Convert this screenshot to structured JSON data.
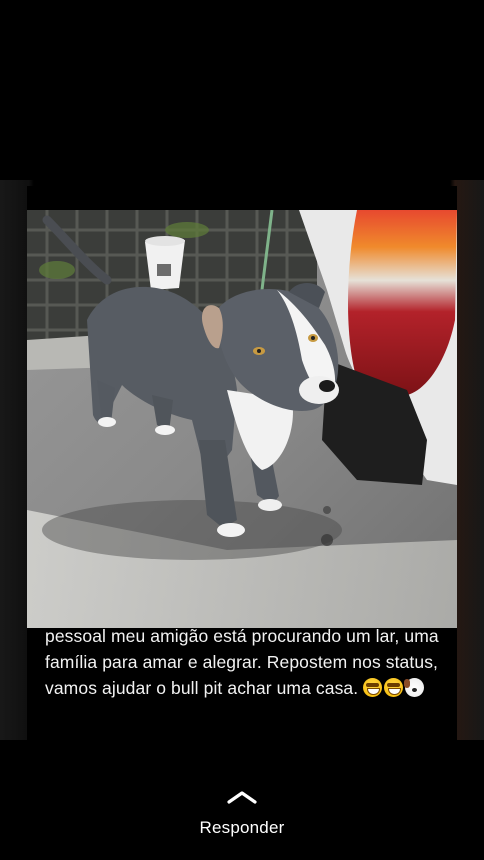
{
  "post": {
    "caption": "pessoal meu amigão está procurando um lar, uma família para amar e alegrar. Repostem nos status, vamos ajudar o bull pit achar uma casa.",
    "emojis": [
      "smiling-face-with-sunglasses-icon",
      "smiling-face-with-sunglasses-icon",
      "dog-face-icon"
    ],
    "photo_subject": "dog-photo"
  },
  "reply": {
    "label": "Responder",
    "icon": "chevron-up-icon"
  },
  "colors": {
    "background": "#000000",
    "text": "#ffffff"
  }
}
